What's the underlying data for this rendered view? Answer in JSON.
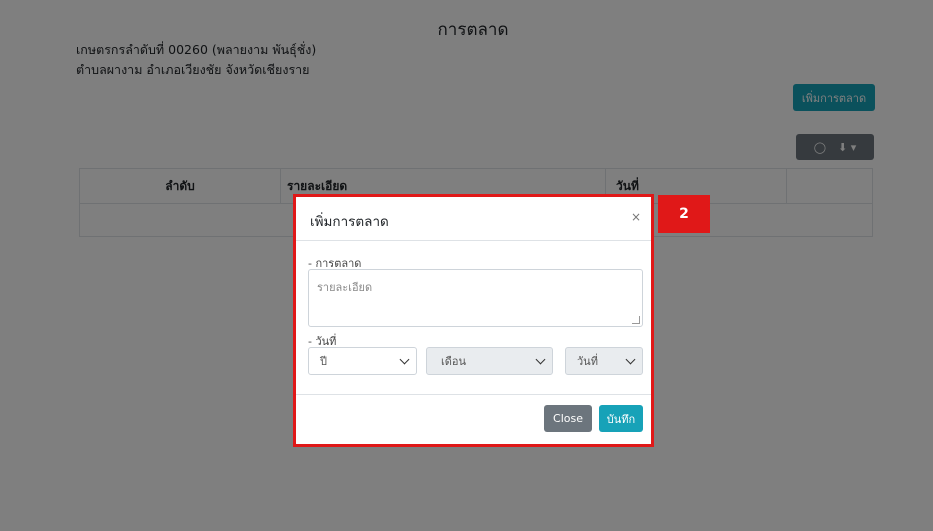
{
  "page": {
    "title": "การตลาด",
    "farmer_line": "เกษตรกรลำดับที่ 00260 (พลายงาม พันธุ์ชั่ง)",
    "location_line": "ตำบลผางาม อำเภอเวียงชัย จังหวัดเชียงราย",
    "add_button": "เพิ่มการตลาด",
    "toolbar": {
      "toggle_icon": "toggle-icon",
      "download_icon": "download-icon"
    },
    "table": {
      "columns": [
        "ลำดับ",
        "รายละเอียด",
        "วันที่",
        ""
      ]
    }
  },
  "modal": {
    "title": "เพิ่มการตลาด",
    "close_symbol": "×",
    "marketing_label": "- การตลาด",
    "detail_placeholder": "รายละเอียด",
    "date_label": "- วันที่",
    "year_select": "ปี",
    "month_select": "เดือน",
    "day_select": "วันที่",
    "close_button": "Close",
    "save_button": "บันทึก"
  },
  "annotation": {
    "badge": "2"
  },
  "colors": {
    "accent": "#17a2b8",
    "secondary": "#6c757d",
    "highlight": "#e01818"
  }
}
